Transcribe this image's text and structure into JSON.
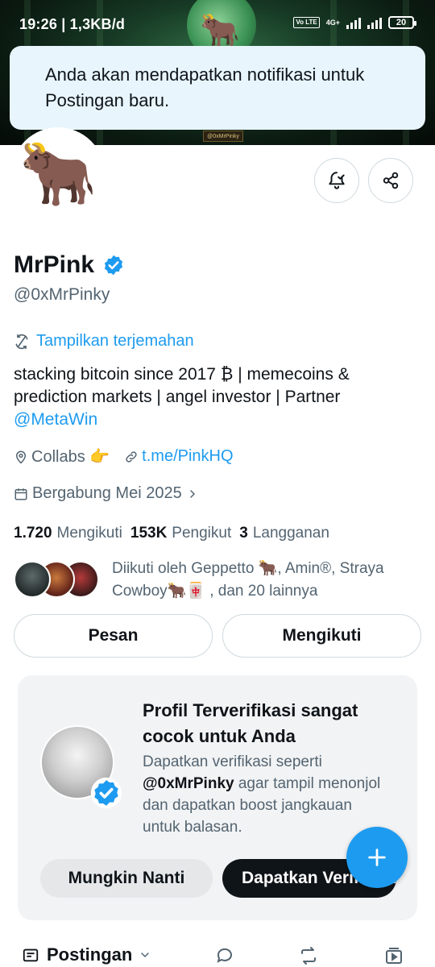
{
  "status_bar": {
    "time_speed": "19:26 | 1,3KB/d",
    "volte": "Vo LTE",
    "network": "4G+",
    "battery": "20"
  },
  "banner": {
    "tag": "@0xMrPinky"
  },
  "toast": {
    "message": "Anda akan mendapatkan notifikasi untuk Postingan baru."
  },
  "profile": {
    "name": "MrPink",
    "handle": "@0xMrPinky",
    "translate_label": "Tampilkan terjemahan",
    "bio_text": "stacking bitcoin since 2017 ₿ | memecoins & prediction markets | angel investor | Partner",
    "bio_mention": "@MetaWin",
    "location": "Collabs 👉",
    "website": "t.me/PinkHQ",
    "joined": "Bergabung Mei 2025"
  },
  "counts": {
    "following_value": "1.720",
    "following_label": "Mengikuti",
    "followers_value": "153K",
    "followers_label": "Pengikut",
    "subs_value": "3",
    "subs_label": "Langganan"
  },
  "followed_by": {
    "text": "Diikuti oleh Geppetto 🐂, Amin®, Straya Cowboy🐂🀄 , dan 20 lainnya"
  },
  "buttons": {
    "message": "Pesan",
    "following": "Mengikuti"
  },
  "promo": {
    "title": "Profil Terverifikasi sangat cocok untuk Anda",
    "desc_before": "Dapatkan verifikasi seperti",
    "desc_handle": "@0xMrPinky",
    "desc_after": "agar tampil menonjol dan dapatkan boost jangkauan untuk balasan.",
    "later_label": "Mungkin Nanti",
    "get_label": "Dapatkan Verifikasi"
  },
  "tabs": {
    "posts_label": "Postingan"
  },
  "colors": {
    "accent": "#1d9bf0",
    "text": "#0f1419",
    "muted": "#536471"
  }
}
